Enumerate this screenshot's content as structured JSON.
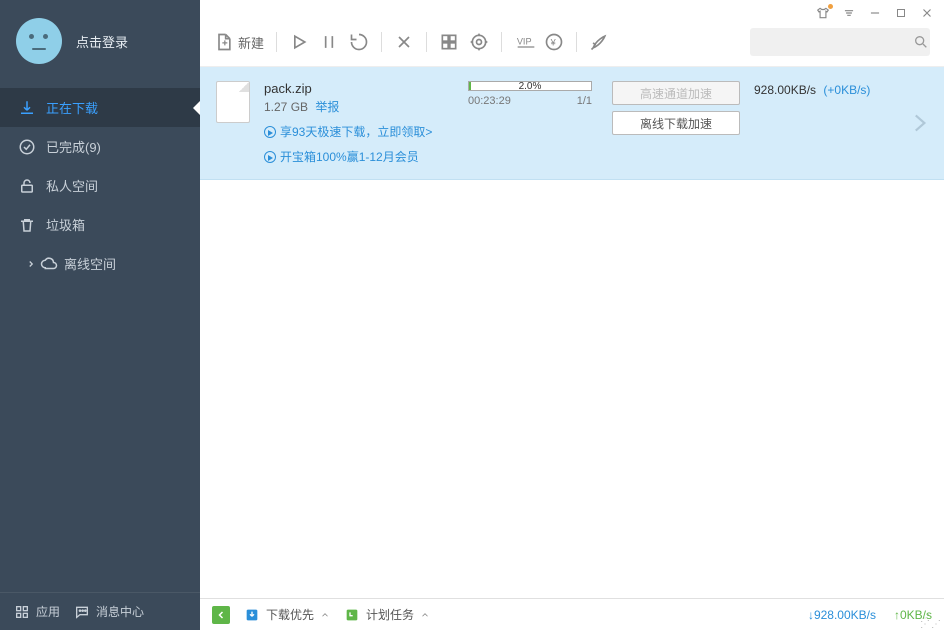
{
  "user": {
    "login_text": "点击登录"
  },
  "sidebar": {
    "items": [
      {
        "label": "正在下载"
      },
      {
        "label": "已完成(9)"
      },
      {
        "label": "私人空间"
      },
      {
        "label": "垃圾箱"
      },
      {
        "label": "离线空间"
      }
    ],
    "app_label": "应用",
    "message_label": "消息中心"
  },
  "toolbar": {
    "new_label": "新建",
    "search_placeholder": ""
  },
  "download": {
    "filename": "pack.zip",
    "size": "1.27 GB",
    "report_label": "举报",
    "promo1": "享93天极速下载，立即领取>",
    "promo2": "开宝箱100%赢1-12月会员",
    "progress_percent": "2.0%",
    "progress_fill_pct": 2,
    "time_remaining": "00:23:29",
    "parts": "1/1",
    "btn_highspeed": "高速通道加速",
    "btn_offline": "离线下载加速",
    "speed": "928.00KB/s",
    "speed_plus": "(+0KB/s)"
  },
  "statusbar": {
    "priority_label": "下载优先",
    "schedule_label": "计划任务",
    "down_speed": "928.00KB/s",
    "up_speed": "0KB/s"
  }
}
